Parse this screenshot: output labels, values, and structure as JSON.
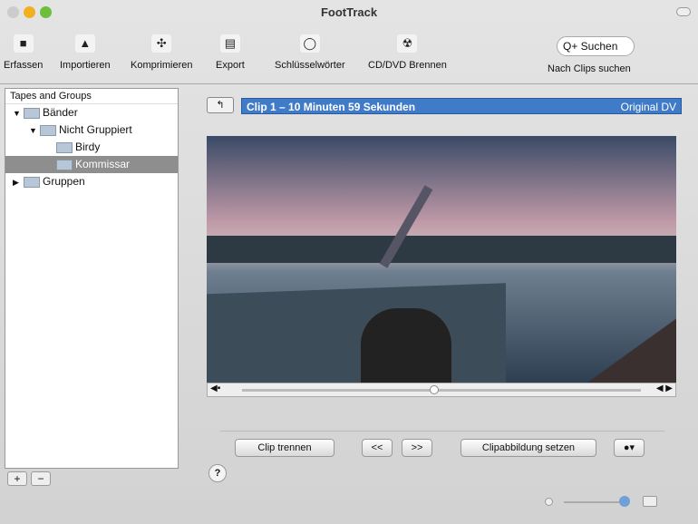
{
  "window": {
    "title": "FootTrack"
  },
  "toolbar": {
    "items": [
      {
        "label": "Erfassen",
        "icon": "camera-icon"
      },
      {
        "label": "Importieren",
        "icon": "import-icon"
      },
      {
        "label": "Komprimieren",
        "icon": "compress-icon"
      },
      {
        "label": "Export",
        "icon": "export-icon"
      },
      {
        "label": "Schlüsselwörter",
        "icon": "keywords-icon"
      },
      {
        "label": "CD/DVD Brennen",
        "icon": "burn-icon"
      }
    ],
    "search_placeholder": "Q+ Suchen",
    "search_label": "Nach Clips suchen"
  },
  "sidebar": {
    "header": "Tapes and Groups",
    "items": [
      {
        "label": "Bänder"
      },
      {
        "label": "Nicht Gruppiert"
      },
      {
        "label": "Birdy"
      },
      {
        "label": "Kommissar"
      },
      {
        "label": "Gruppen"
      }
    ],
    "add": "+",
    "remove": "−"
  },
  "clip": {
    "title": "Clip 1 – 10 Minuten 59 Sekunden",
    "format": "Original DV",
    "position": 0.48
  },
  "controls": {
    "split": "Clip trennen",
    "prev": "<<",
    "next": ">>",
    "set_thumb": "Clipabbildung setzen",
    "action": "●▾",
    "help": "?"
  }
}
